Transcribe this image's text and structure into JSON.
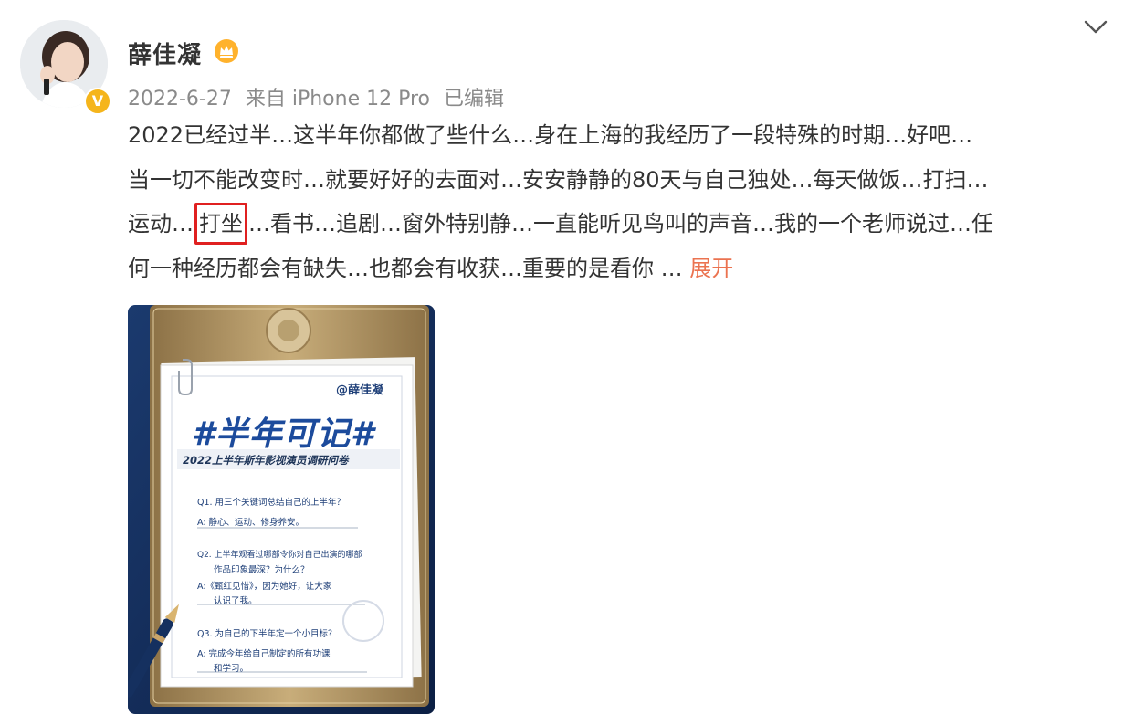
{
  "post": {
    "username": "薛佳凝",
    "date": "2022-6-27",
    "source": "来自 iPhone 12 Pro",
    "edited": "已编辑",
    "text_lines": [
      "2022已经过半…这半年你都做了些什么…身在上海的我经历了一段特殊的时期…好吧…",
      "当一切不能改变时…就要好好的去面对…安安静静的80天与自己独处…每天做饭…打扫…"
    ],
    "line3_before": "运动…",
    "line3_highlight": "打坐",
    "line3_after": "…看书…追剧…窗外特别静…一直能听见鸟叫的声音…我的一个老师说过…任",
    "line4": "何一种经历都会有缺失…也都会有收获…重要的是看你  … ",
    "expand_label": "展开",
    "verified_badge": "V"
  },
  "poster": {
    "handle": "@薛佳凝",
    "title": "#半年可记#",
    "subtitle": "2022上半年斯年影视演员调研问卷",
    "q1": "Q1. 用三个关键词总结自己的上半年？",
    "a1": "A: 静心、运动、修身养安。",
    "q2a": "Q2. 上半年观看过哪部令你对自己出演的哪部",
    "q2b": "作品印象最深？为什么？",
    "a2a": "A:《甄红见惜》，因为她好，让大家",
    "a2b": "认识了我。",
    "q3": "Q3. 为自己的下半年定一个小目标？",
    "a3a": "A: 完成今年给自己制定的所有功课",
    "a3b": "和学习。"
  },
  "colors": {
    "accent": "#eb7350",
    "highlight_box": "#e02020",
    "badge": "#f5b51c"
  },
  "icons": {
    "menu": "chevron-down-icon",
    "crown": "crown-icon",
    "avatar": "avatar-photo"
  }
}
